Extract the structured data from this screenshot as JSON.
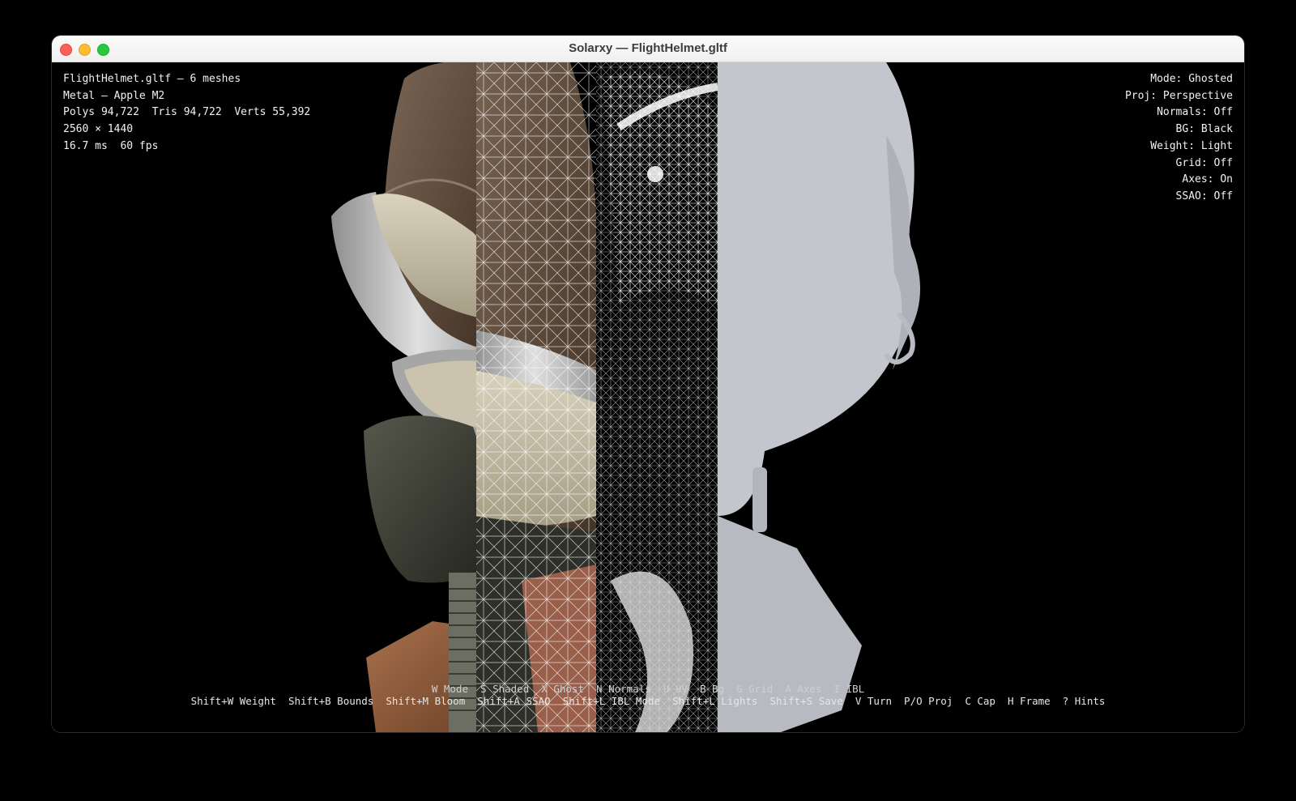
{
  "window": {
    "title": "Solarxy — FlightHelmet.gltf"
  },
  "stats": {
    "file": "FlightHelmet.gltf — 6 meshes",
    "backend": "Metal — Apple M2",
    "geometry": "Polys 94,722  Tris 94,722  Verts 55,392",
    "resolution": "2560 × 1440",
    "timing": "16.7 ms  60 fps"
  },
  "settings": {
    "mode": "Mode: Ghosted",
    "proj": "Proj: Perspective",
    "normals": "Normals: Off",
    "bg": "BG: Black",
    "weight": "Weight: Light",
    "grid": "Grid: Off",
    "axes": "Axes: On",
    "ssao": "SSAO: Off"
  },
  "hints": {
    "line1": "W Mode  S Shaded  X Ghost  N Normals  U UV  B Bg  G Grid  A Axes  I IBL",
    "line2": "Shift+W Weight  Shift+B Bounds  Shift+M Bloom  Shift+A SSAO  Shift+L IBL Mode  Shift+L Lights  Shift+S Save  V Turn  P/O Proj  C Cap  H Frame  ? Hints"
  },
  "colors": {
    "background": "#000000",
    "leather": "#5a4a3f",
    "goggle_metal": "#b8b8b8",
    "lens": "#c8bfa8",
    "mask": "#3e4137",
    "base_wood": "#8a5a3c",
    "wire": "#ffffff",
    "ghost": "#c3c6cc"
  }
}
